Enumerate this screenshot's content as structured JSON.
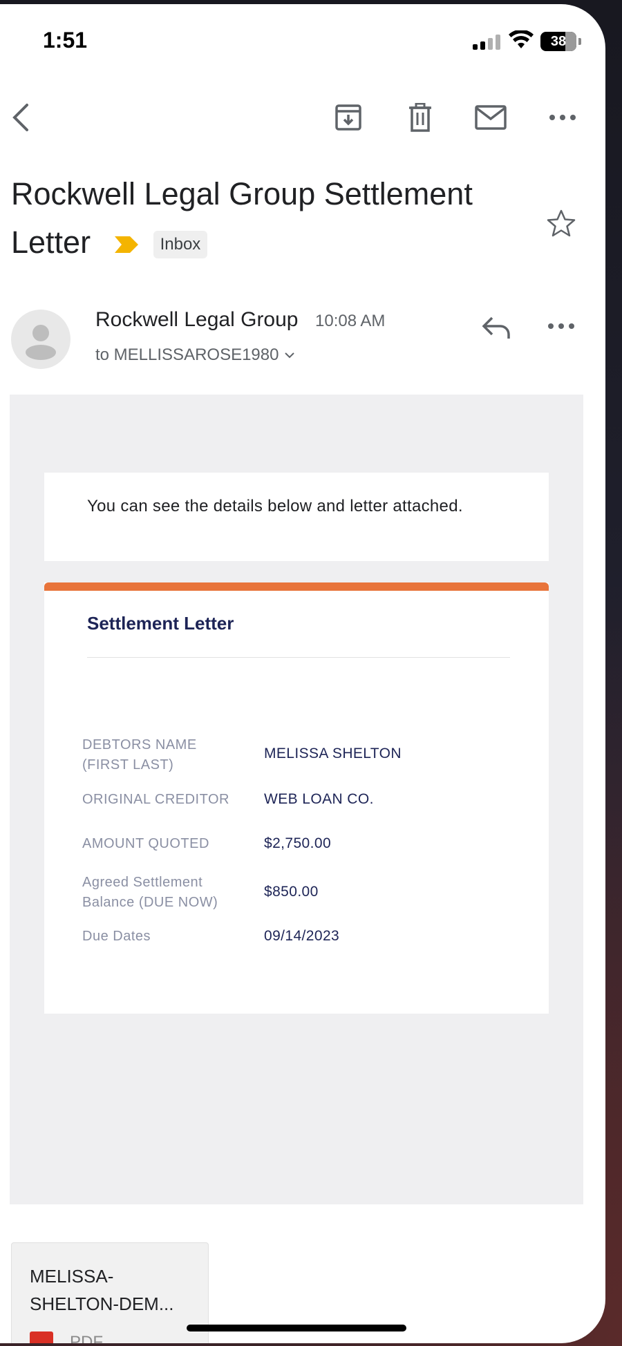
{
  "status_bar": {
    "time": "1:51",
    "battery": "38"
  },
  "email": {
    "subject": "Rockwell Legal Group Settlement Letter",
    "label": "Inbox",
    "sender": "Rockwell Legal Group",
    "time": "10:08 AM",
    "recipient": "to MELLISSAROSE1980"
  },
  "body": {
    "intro": "You can see the details below and letter attached.",
    "letter_title": "Settlement Letter",
    "rows": [
      {
        "label": "DEBTORS NAME (FIRST LAST)",
        "value": "MELISSA SHELTON"
      },
      {
        "label": "ORIGINAL CREDITOR",
        "value": "WEB LOAN CO."
      },
      {
        "label": "AMOUNT QUOTED",
        "value": "$2,750.00"
      },
      {
        "label": "Agreed Settlement Balance (DUE NOW)",
        "value": "$850.00"
      },
      {
        "label": "Due Dates",
        "value": "09/14/2023"
      }
    ]
  },
  "attachment": {
    "name": "MELISSA-SHELTON-DEM...",
    "type": "PDF"
  },
  "colors": {
    "accent": "#e8743b",
    "label_arrow": "#f4b400",
    "heading": "#1d2456"
  },
  "icons": [
    "back-icon",
    "archive-icon",
    "trash-icon",
    "mail-icon",
    "more-icon",
    "star-icon",
    "reply-icon",
    "chevron-down-icon",
    "pdf-icon"
  ]
}
